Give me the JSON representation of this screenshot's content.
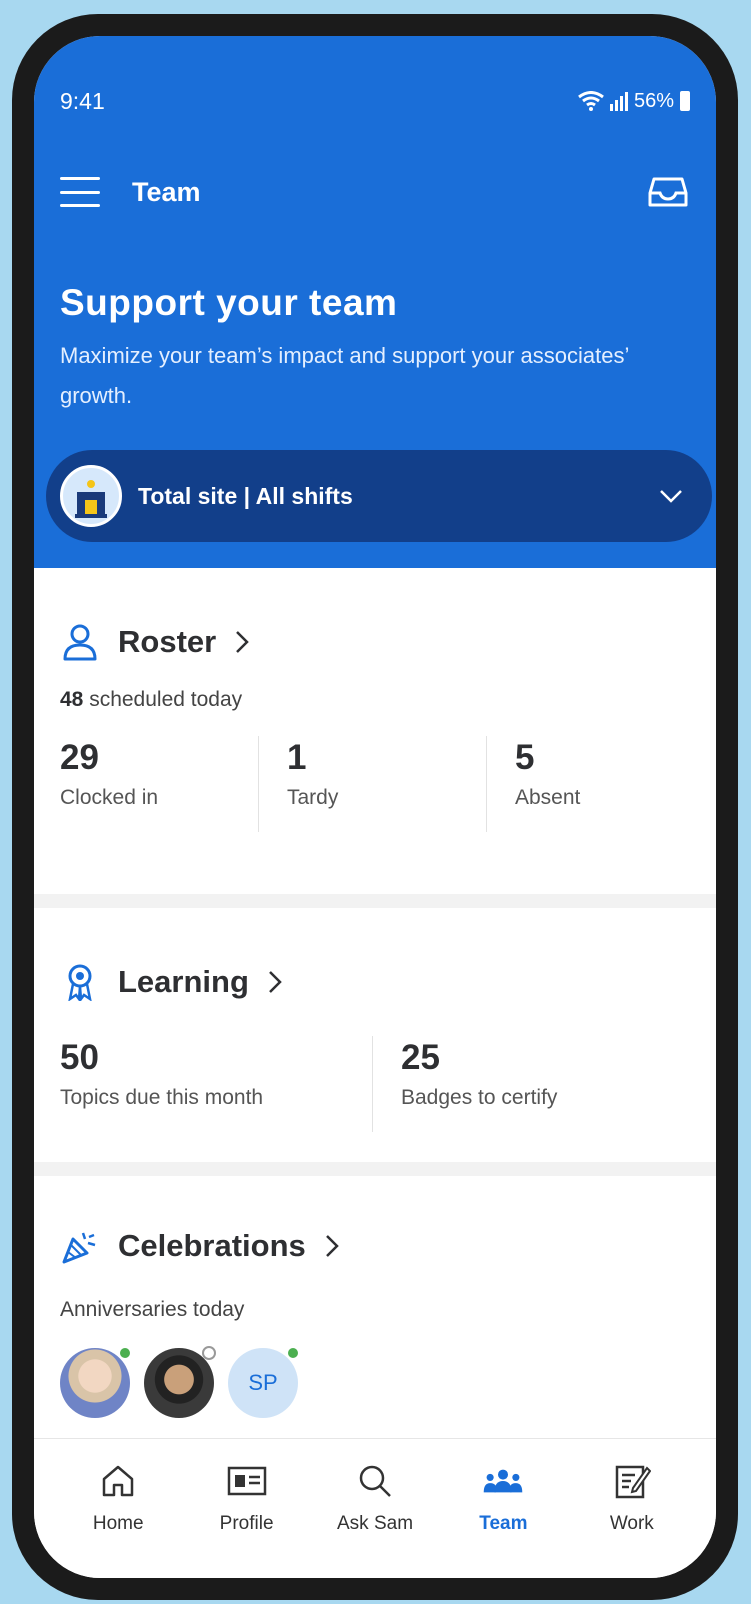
{
  "status": {
    "time": "9:41",
    "battery": "56%"
  },
  "appbar": {
    "title": "Team"
  },
  "hero": {
    "title": "Support your team",
    "subtitle": "Maximize your team’s impact and support your associates’ growth."
  },
  "site_selector": {
    "label": "Total site | All shifts"
  },
  "roster": {
    "title": "Roster",
    "scheduled_count": "48",
    "scheduled_text": " scheduled today",
    "stats": [
      {
        "value": "29",
        "label": "Clocked in"
      },
      {
        "value": "1",
        "label": "Tardy"
      },
      {
        "value": "5",
        "label": "Absent"
      }
    ]
  },
  "learning": {
    "title": "Learning",
    "stats": [
      {
        "value": "50",
        "label": "Topics due this month"
      },
      {
        "value": "25",
        "label": "Badges to certify"
      }
    ]
  },
  "celebrations": {
    "title": "Celebrations",
    "subtitle": "Anniversaries today",
    "avatars": [
      {
        "initials": "",
        "status": "online"
      },
      {
        "initials": "",
        "status": "offline"
      },
      {
        "initials": "SP",
        "status": "online"
      }
    ]
  },
  "nav": {
    "items": [
      {
        "label": "Home",
        "icon": "home-icon"
      },
      {
        "label": "Profile",
        "icon": "profile-card-icon"
      },
      {
        "label": "Ask Sam",
        "icon": "search-icon"
      },
      {
        "label": "Team",
        "icon": "team-icon",
        "active": true
      },
      {
        "label": "Work",
        "icon": "work-icon"
      }
    ]
  },
  "colors": {
    "brand_blue": "#1a6ed8",
    "selector_navy": "#123f8a",
    "online_green": "#4caf50"
  }
}
